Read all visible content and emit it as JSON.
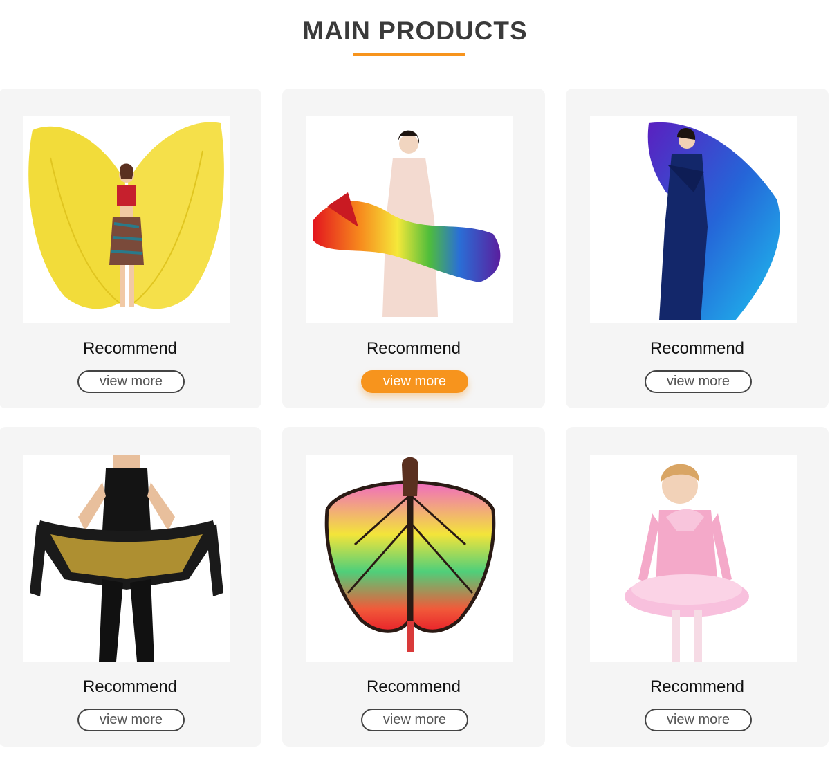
{
  "header": {
    "title": "MAIN PRODUCTS"
  },
  "colors": {
    "accent": "#f7941d",
    "card_bg": "#f5f5f5",
    "text": "#333333"
  },
  "products": [
    {
      "label": "Recommend",
      "button": "view more",
      "image": "yellow-isis-wings-dancer"
    },
    {
      "label": "Recommend",
      "button": "view more",
      "image": "rainbow-silk-fan-veil",
      "button_state": "hover"
    },
    {
      "label": "Recommend",
      "button": "view more",
      "image": "blue-purple-silk-veil"
    },
    {
      "label": "Recommend",
      "button": "view more",
      "image": "gold-coin-hip-scarf"
    },
    {
      "label": "Recommend",
      "button": "view more",
      "image": "butterfly-wing-cape"
    },
    {
      "label": "Recommend",
      "button": "view more",
      "image": "pink-ballet-tutu"
    }
  ]
}
